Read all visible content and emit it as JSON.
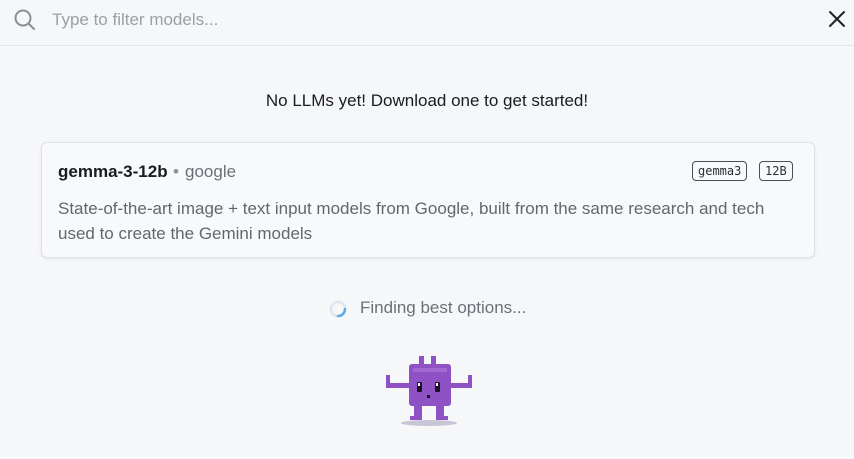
{
  "search": {
    "placeholder": "Type to filter models...",
    "value": ""
  },
  "empty_state": {
    "title": "No LLMs yet! Download one to get started!"
  },
  "model_card": {
    "name": "gemma-3-12b",
    "separator": "•",
    "author": "google",
    "tags": [
      "gemma3",
      "12B"
    ],
    "description": "State-of-the-art image + text input models from Google, built from the same research and tech used to create the Gemini models"
  },
  "loading": {
    "text": "Finding best options..."
  },
  "colors": {
    "background": "#f6f7f9",
    "mascot": "#8f52c4",
    "spinner": "#5aa8e6"
  }
}
